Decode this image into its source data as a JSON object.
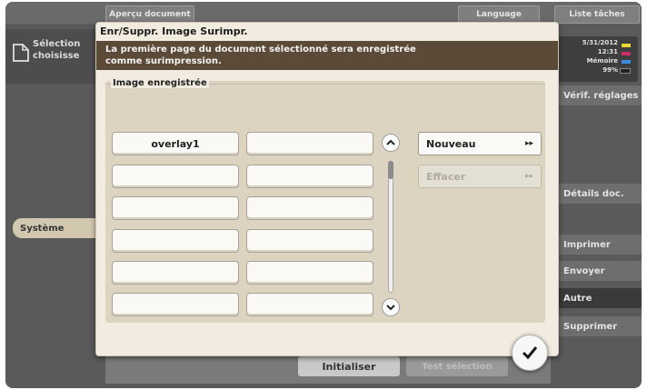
{
  "topbar": {
    "preview_label": "Aperçu document",
    "language_label": "Language",
    "job_list_label": "Liste tâches"
  },
  "left": {
    "selection_label": "Sélection\nchoisisse",
    "system_label": "Système"
  },
  "status": {
    "date": "5/31/2012",
    "time": "12:31",
    "memory_label": "Mémoire",
    "memory_value": "99%",
    "ink_colors": {
      "Y": "#e8d833",
      "M": "#c8306a",
      "C": "#3c8ad8",
      "K": "#222222"
    }
  },
  "right_panel": {
    "verify_settings": "Vérif. réglages",
    "doc_details": "Détails doc.",
    "print": "Imprimer",
    "send": "Envoyer",
    "other": "Autre",
    "delete": "Supprimer"
  },
  "bottom": {
    "initialize": "Initialiser",
    "test_selection": "Test sélection"
  },
  "dialog": {
    "title": "Enr/Suppr. Image Surimpr.",
    "message": "La première page du document sélectionné sera enregistrée\ncomme surimpression.",
    "group_label": "Image enregistrée",
    "slots": [
      "overlay1",
      "",
      "",
      "",
      "",
      "",
      "",
      "",
      "",
      "",
      "",
      ""
    ],
    "new_button": "Nouveau",
    "erase_button": "Effacer"
  },
  "colors": {
    "dialog_bg": "#f1ebe0",
    "message_bg": "#5c4a38",
    "inner_bg": "#dcd4c1",
    "screen_bg": "#5a5a5a"
  }
}
